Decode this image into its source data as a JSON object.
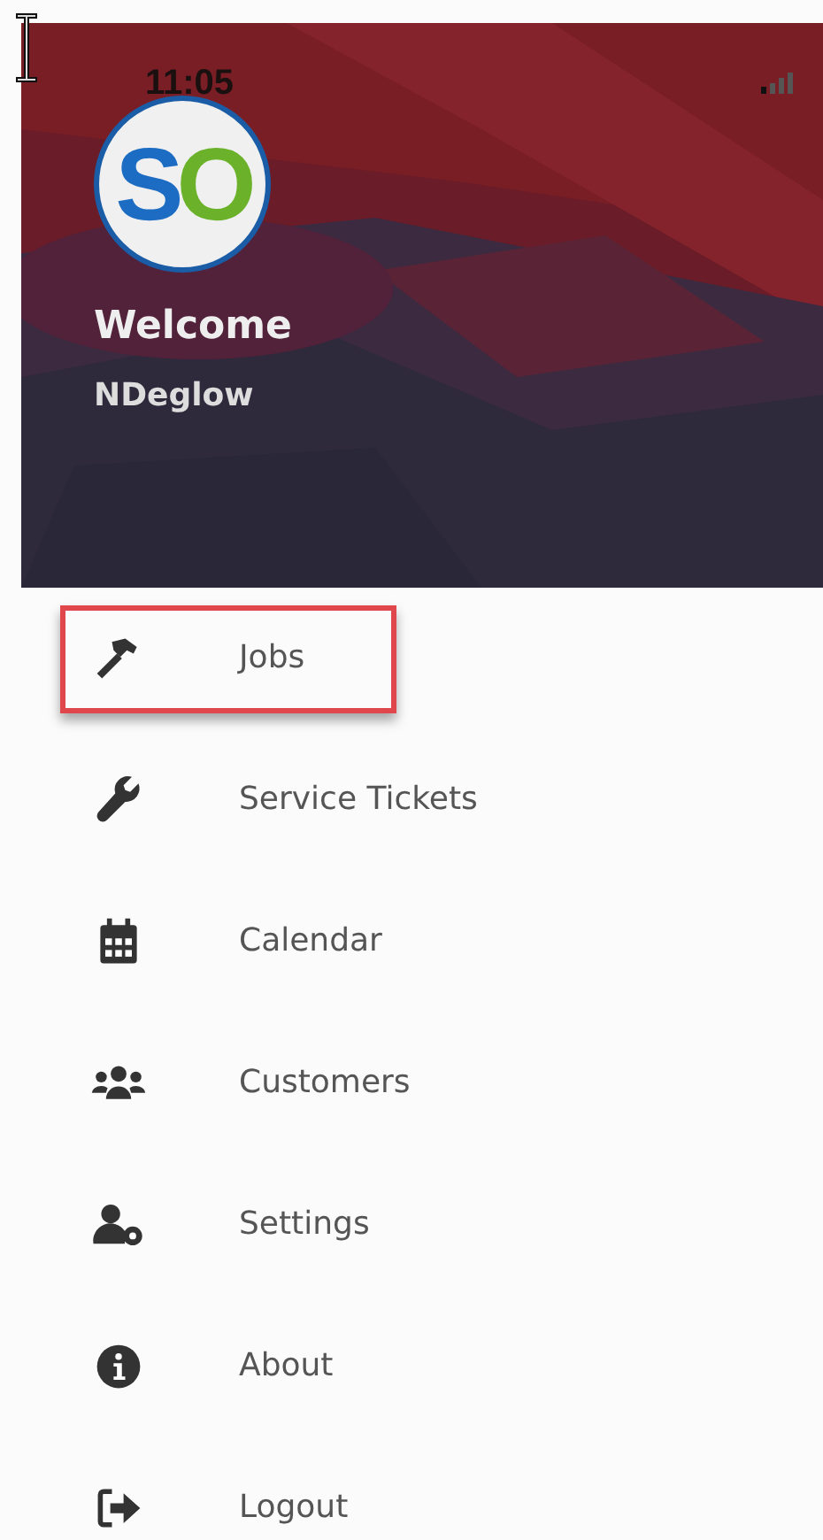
{
  "status_bar": {
    "time": "11:05"
  },
  "header": {
    "logo": [
      {
        "text": "S",
        "color": "#1c6cc4"
      },
      {
        "text": "O",
        "color": "#6bb22a"
      }
    ],
    "greeting": "Welcome",
    "username": "NDeglow"
  },
  "menu": [
    {
      "label": "Jobs",
      "highlighted": true
    },
    {
      "label": "Service Tickets",
      "highlighted": false
    },
    {
      "label": "Calendar",
      "highlighted": false
    },
    {
      "label": "Customers",
      "highlighted": false
    },
    {
      "label": "Settings",
      "highlighted": false
    },
    {
      "label": "About",
      "highlighted": false
    },
    {
      "label": "Logout",
      "highlighted": false
    }
  ]
}
